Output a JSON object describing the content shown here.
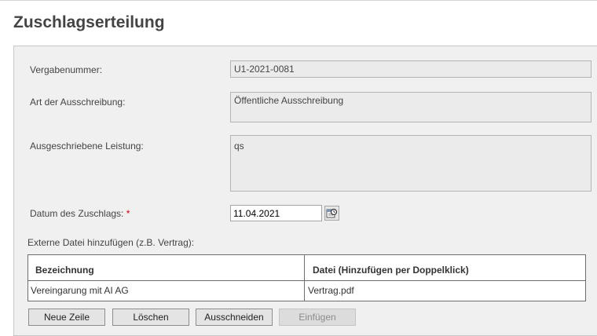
{
  "page": {
    "title": "Zuschlagserteilung"
  },
  "form": {
    "vergabenummer": {
      "label": "Vergabenummer:",
      "value": "U1-2021-0081"
    },
    "art": {
      "label": "Art der Ausschreibung:",
      "value": "Öffentliche Ausschreibung"
    },
    "leistung": {
      "label": "Ausgeschriebene Leistung:",
      "value": "qs"
    },
    "datum": {
      "label": "Datum des Zuschlags:",
      "required_marker": "*",
      "value": "11.04.2021"
    }
  },
  "files": {
    "label": "Externe Datei hinzufügen (z.B. Vertrag):",
    "columns": [
      "Bezeichnung",
      "Datei (Hinzufügen per Doppelklick)"
    ],
    "rows": [
      {
        "bezeichnung": "Vereingarung mit AI AG",
        "datei": "Vertrag.pdf"
      }
    ]
  },
  "buttons": {
    "neue_zeile": "Neue Zeile",
    "loeschen": "Löschen",
    "ausschneiden": "Ausschneiden",
    "einfuegen": "Einfügen"
  },
  "icons": {
    "calendar": "calendar-icon"
  }
}
